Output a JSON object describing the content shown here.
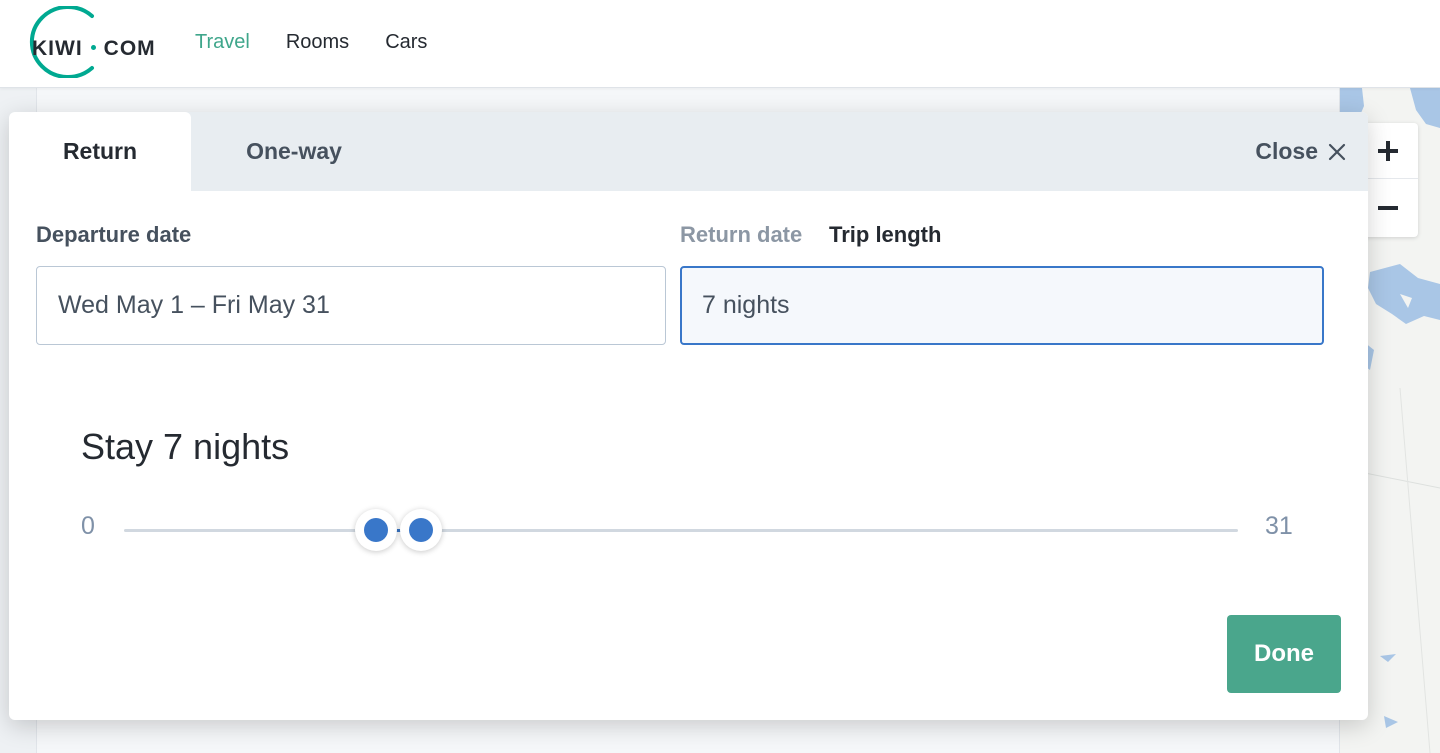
{
  "brand": {
    "name_left": "KIWI",
    "name_right": "COM",
    "accent_color": "#00a991"
  },
  "nav": {
    "items": [
      {
        "label": "Travel",
        "active": true
      },
      {
        "label": "Rooms",
        "active": false
      },
      {
        "label": "Cars",
        "active": false
      }
    ]
  },
  "modal": {
    "tabs": {
      "return_label": "Return",
      "oneway_label": "One-way",
      "selected": "Return"
    },
    "close_label": "Close",
    "departure": {
      "label": "Departure date",
      "value": "Wed May 1 – Fri May 31"
    },
    "return_date_label": "Return date",
    "trip_length": {
      "label": "Trip length",
      "value": "7 nights",
      "selected": true
    },
    "stay_title": "Stay 7 nights",
    "slider": {
      "min_label": "0",
      "max_label": "31",
      "min": 0,
      "max": 31,
      "low": 7,
      "high": 8
    },
    "done_label": "Done",
    "accent_color": "#3977c9",
    "done_color": "#4aa68c"
  },
  "map": {
    "zoom_in_icon": "plus-icon",
    "zoom_out_icon": "minus-icon"
  }
}
